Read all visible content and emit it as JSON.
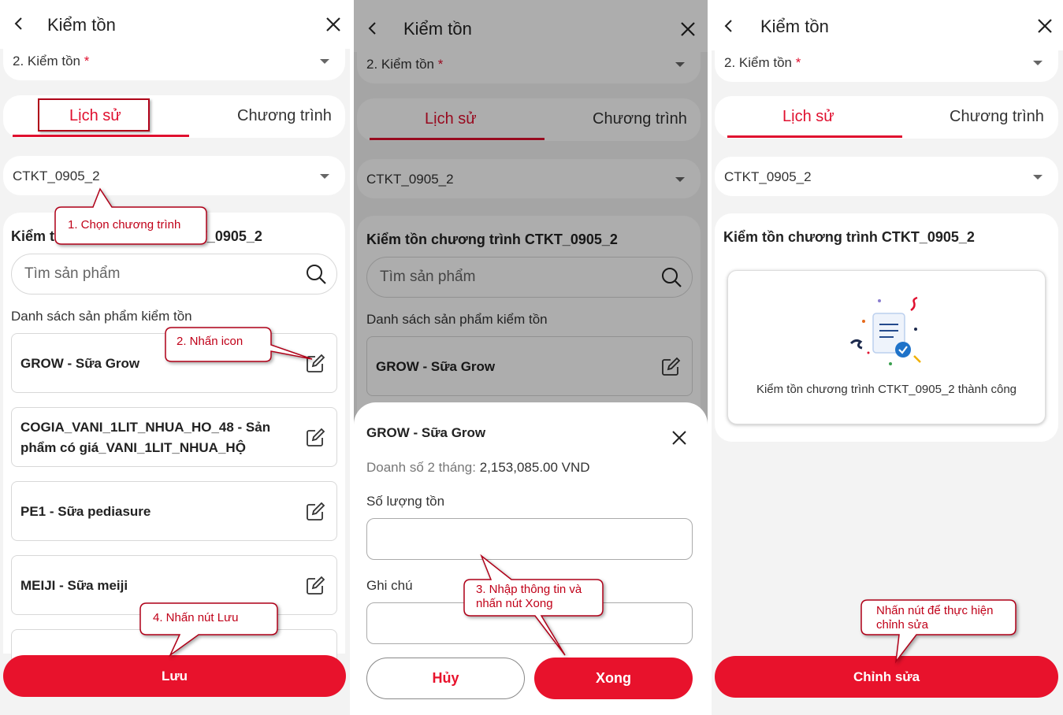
{
  "header": {
    "title": "Kiểm tồn"
  },
  "dropdowns": {
    "type_label": "2. Kiểm tồn",
    "required_mark": "*",
    "program_value": "CTKT_0905_2"
  },
  "tabs": {
    "history": "Lịch sử",
    "program": "Chương trình"
  },
  "main": {
    "section_title": "Kiểm tồn chương trình CTKT_0905_2",
    "search_placeholder": "Tìm sản phẩm",
    "list_label": "Danh sách sản phẩm kiểm tồn",
    "products": [
      "GROW - Sữa Grow",
      "COGIA_VANI_1LIT_NHUA_HO_48 - Sản phẩm có giá_VANI_1LIT_NHUA_HỘ",
      "PE1 - Sữa pediasure",
      "MEIJI - Sữa meiji"
    ]
  },
  "panel1": {
    "save_button": "Lưu"
  },
  "sheet": {
    "title": "GROW - Sữa Grow",
    "sales_label": "Doanh số 2 tháng:",
    "sales_value": "2,153,085.00 VND",
    "stock_label": "Số lượng tồn",
    "note_label": "Ghi chú",
    "cancel_button": "Hủy",
    "done_button": "Xong"
  },
  "panel3": {
    "success_message": "Kiểm tồn chương trình CTKT_0905_2 thành công",
    "edit_button": "Chỉnh sửa"
  },
  "callouts": {
    "c1": "1. Chọn chương trình",
    "c2": "2. Nhấn icon",
    "c3": "3. Nhập thông tin và nhấn nút Xong",
    "c4": "4. Nhấn nút Lưu",
    "c5": "Nhấn nút để thực hiện chỉnh sửa"
  },
  "colors": {
    "accent": "#e8122c",
    "callout": "#c00018"
  },
  "icons": [
    "back-arrow-icon",
    "close-icon",
    "caret-down-icon",
    "search-icon",
    "edit-icon",
    "document-check-icon"
  ]
}
